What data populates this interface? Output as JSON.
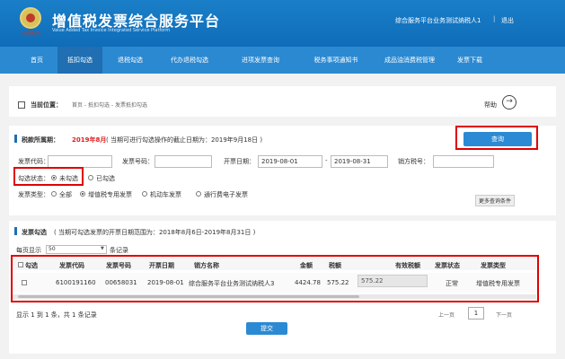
{
  "header": {
    "title": "增值税发票综合服务平台",
    "subtitle": "Value Added Tax Invoice Integrated Service Platform",
    "logo_text": "中国税务",
    "user": "综合服务平台业务测试纳税人1",
    "separator": "|",
    "logout": "退出"
  },
  "nav": [
    "首页",
    "抵扣勾选",
    "退税勾选",
    "代办退税勾选",
    "进项发票查询",
    "税务事项通知书",
    "成品油消费税管理",
    "发票下载"
  ],
  "breadcrumb": {
    "label": "当前位置：",
    "path": "首页 - 抵扣勾选 - 发票抵扣勾选",
    "help": "帮助",
    "help_icon": "→"
  },
  "period": {
    "label": "税款所属期：",
    "value": "2019年8月",
    "note": "( 当期可进行勾选操作的截止日期为：2019年9月18日 )",
    "query_button": "查询"
  },
  "filters": {
    "invoice_code_label": "发票代码：",
    "invoice_number_label": "发票号码：",
    "date_label": "开票日期：",
    "date_from": "2019-08-01",
    "date_sep": "-",
    "date_to": "2019-08-31",
    "seller_tax_label": "销方税号：",
    "status_label": "勾选状态：",
    "status_options": [
      "未勾选",
      "已勾选"
    ],
    "type_label": "发票类型：",
    "type_options": [
      "全部",
      "增值税专用发票",
      "机动车发票",
      "通行费电子发票"
    ],
    "more_button": "更多查询条件"
  },
  "results": {
    "title": "发票勾选",
    "note": "( 当期可勾选发票的开票日期范围为：2018年8月6日-2019年8月31日 )",
    "page_size_label": "每页显示",
    "page_size": "50",
    "page_size_suffix": "条记录",
    "columns": [
      "勾选",
      "发票代码",
      "发票号码",
      "开票日期",
      "销方名称",
      "金额",
      "税额",
      "有效税额",
      "发票状态",
      "发票类型"
    ],
    "rows": [
      {
        "code": "6100191160",
        "number": "00658031",
        "date": "2019-08-01",
        "seller": "综合服务平台业务测试纳税人3",
        "amount": "4424.78",
        "tax": "575.22",
        "valid_tax": "575.22",
        "status": "正常",
        "type": "增值税专用发票"
      }
    ],
    "pager_info": "显示 1 到 1 条，共 1 条记录",
    "prev": "上一页",
    "page": "1",
    "next": "下一页",
    "submit": "提交"
  }
}
